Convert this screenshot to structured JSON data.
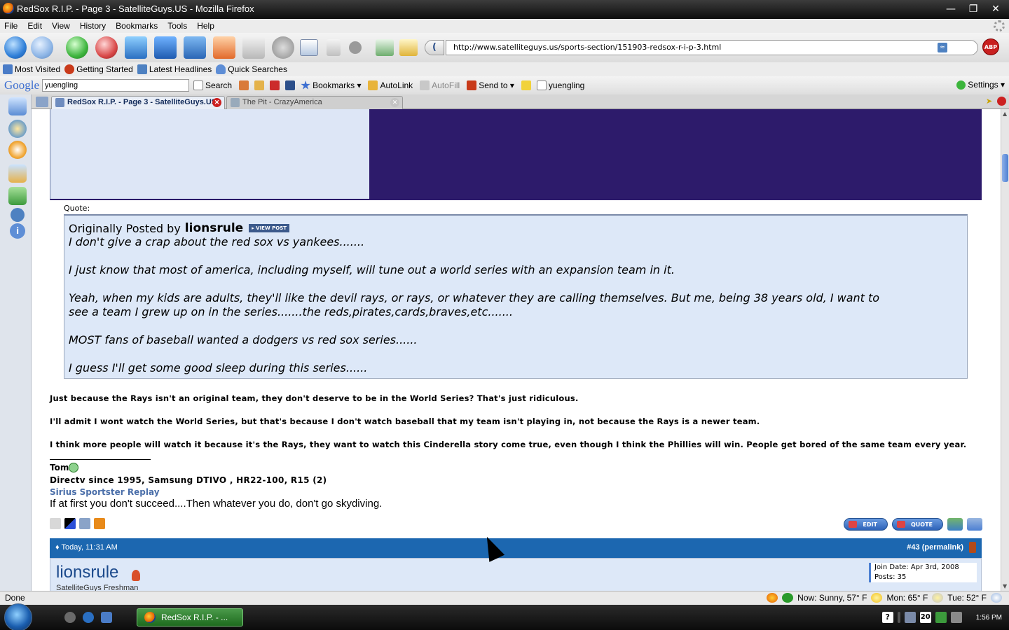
{
  "window": {
    "title": "RedSox R.I.P. - Page 3 - SatelliteGuys.US - Mozilla Firefox",
    "controls": [
      "—",
      "❐",
      "✕"
    ]
  },
  "menubar": [
    "File",
    "Edit",
    "View",
    "History",
    "Bookmarks",
    "Tools",
    "Help"
  ],
  "nav": {
    "url": "http://www.satelliteguys.us/sports-section/151903-redsox-r-i-p-3.html",
    "abp_label": "ABP"
  },
  "bookmarks": [
    "Most Visited",
    "Getting Started",
    "Latest Headlines",
    "Quick Searches"
  ],
  "google_toolbar": {
    "logo": "Google",
    "query": "yuengling",
    "search_label": "Search",
    "bookmarks_label": "Bookmarks",
    "autolink_label": "AutoLink",
    "autofill_label": "AutoFill",
    "sendto_label": "Send to",
    "highlight_term": "yuengling",
    "settings_label": "Settings"
  },
  "tabs": [
    {
      "label": "RedSox R.I.P. - Page 3 - SatelliteGuys.US",
      "active": true
    },
    {
      "label": "The Pit - CrazyAmerica",
      "active": false
    }
  ],
  "quote": {
    "label": "Quote:",
    "originally_posted_by": "Originally Posted by",
    "author": "lionsrule",
    "view_post": "VIEW POST",
    "lines": [
      "I don't give a crap about the red sox vs yankees.......",
      "I just know that most of america, including myself, will tune out a world series with an expansion team in it.",
      "Yeah, when my kids are adults, they'll like the devil rays, or rays, or whatever they are calling themselves. But me, being 38 years old, I want to",
      "see a team I grew up on in the series.......the reds,pirates,cards,braves,etc.......",
      "MOST fans of baseball wanted a dodgers vs red sox series......",
      "I guess I'll get some good sleep during this series......"
    ]
  },
  "post": {
    "paragraphs": [
      "Just because the Rays isn't an original team, they don't deserve to be in the World Series? That's just ridiculous.",
      "I'll admit I wont watch the World Series, but that's because I don't watch baseball that my team isn't playing in, not because the Rays is a newer team.",
      "I think more people will watch it because it's the Rays, they want to watch this Cinderella story come true, even though I think the Phillies will win. People get bored of the same team every year."
    ],
    "signature": {
      "name": "Tom",
      "line2": "Directv since 1995, Samsung DTIVO , HR22-100, R15 (2)",
      "line3": "Sirius Sportster Replay",
      "line4": "If at first you don't succeed....Then whatever you do, don't go skydiving."
    },
    "actions": {
      "edit": "EDIT",
      "quote": "QUOTE"
    }
  },
  "next_post": {
    "date": "Today, 11:31 AM",
    "permalink": "#43 (permalink)",
    "username": "lionsrule",
    "rank": "SatelliteGuys Freshman",
    "join_date": "Join Date: Apr 3rd, 2008",
    "posts": "Posts: 35"
  },
  "statusbar": {
    "status": "Done",
    "now": "Now: Sunny, 57° F",
    "mon": "Mon: 65° F",
    "tue": "Tue: 52° F"
  },
  "taskbar": {
    "app_label": "RedSox R.I.P. - ...",
    "tray_date_icon": "20",
    "clock": "1:56 PM"
  }
}
